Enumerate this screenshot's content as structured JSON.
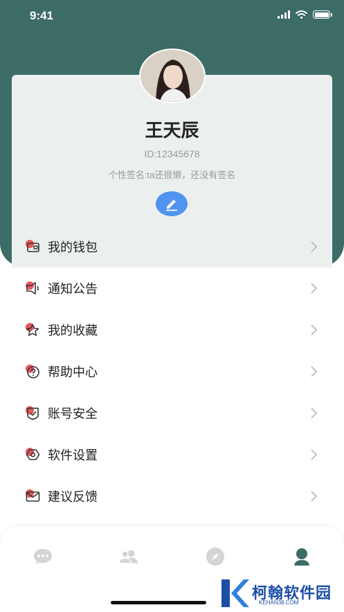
{
  "status_bar": {
    "time": "9:41"
  },
  "profile": {
    "name": "王天辰",
    "id_text": "ID:12345678",
    "signature": "个性签名:ta还很懒，还没有签名",
    "edit_icon": "pencil-icon"
  },
  "menu": [
    {
      "label": "我的钱包",
      "icon": "wallet-icon"
    },
    {
      "label": "通知公告",
      "icon": "megaphone-icon"
    },
    {
      "label": "我的收藏",
      "icon": "star-icon"
    },
    {
      "label": "帮助中心",
      "icon": "help-icon"
    },
    {
      "label": "账号安全",
      "icon": "shield-check-icon"
    },
    {
      "label": "软件设置",
      "icon": "settings-icon"
    },
    {
      "label": "建议反馈",
      "icon": "mail-icon"
    }
  ],
  "tabs": [
    {
      "icon": "chat-icon",
      "active": false
    },
    {
      "icon": "contacts-icon",
      "active": false
    },
    {
      "icon": "compass-icon",
      "active": false
    },
    {
      "icon": "profile-icon",
      "active": true
    }
  ],
  "colors": {
    "header": "#3d6c67",
    "card": "#ebf0ef",
    "accent_red": "#e8575f",
    "edit_blue": "#4f94ef",
    "tab_inactive": "#d4d4d4",
    "tab_active": "#3d6c67"
  },
  "watermark": {
    "text": "柯翰软件园",
    "sub": "KEHAN38.COM"
  }
}
